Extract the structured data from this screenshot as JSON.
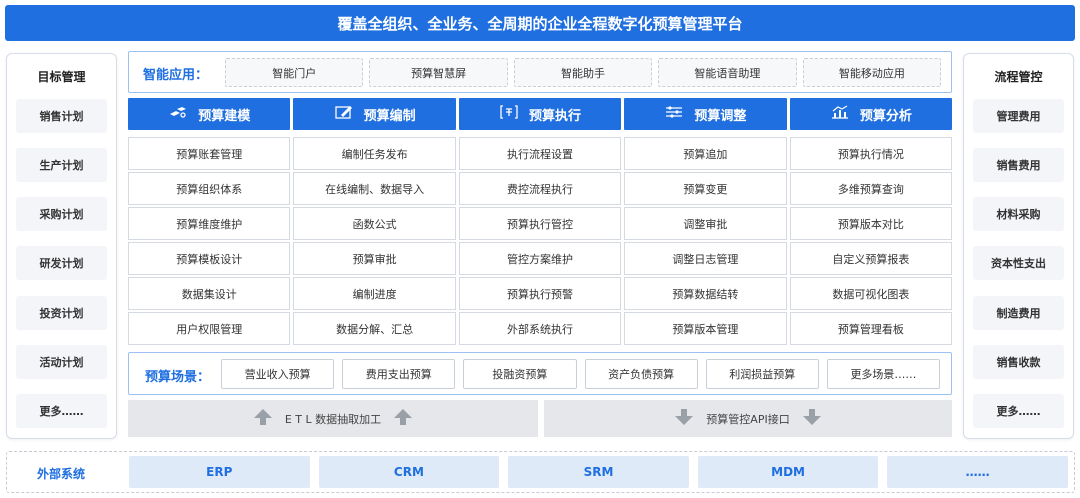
{
  "banner": {
    "title": "覆盖全组织、全业务、全周期的企业全程数字化预算管理平台"
  },
  "left_panel": {
    "title": "目标管理",
    "items": [
      "销售计划",
      "生产计划",
      "采购计划",
      "研发计划",
      "投资计划",
      "活动计划",
      "更多……"
    ]
  },
  "right_panel": {
    "title": "流程管控",
    "items": [
      "管理费用",
      "销售费用",
      "材料采购",
      "资本性支出",
      "制造费用",
      "销售收款",
      "更多……"
    ]
  },
  "smart_apps": {
    "label": "智能应用：",
    "items": [
      "智能门户",
      "预算智慧屏",
      "智能助手",
      "智能语音助理",
      "智能移动应用"
    ]
  },
  "modules": [
    {
      "title": "预算建模",
      "icon": "modeling-icon",
      "items": [
        "预算账套管理",
        "预算组织体系",
        "预算维度维护",
        "预算模板设计",
        "数据集设计",
        "用户权限管理"
      ]
    },
    {
      "title": "预算编制",
      "icon": "edit-icon",
      "items": [
        "编制任务发布",
        "在线编制、数据导入",
        "函数公式",
        "预算审批",
        "编制进度",
        "数据分解、汇总"
      ]
    },
    {
      "title": "预算执行",
      "icon": "execute-icon",
      "items": [
        "执行流程设置",
        "费控流程执行",
        "预算执行管控",
        "管控方案维护",
        "预算执行预警",
        "外部系统执行"
      ]
    },
    {
      "title": "预算调整",
      "icon": "adjust-icon",
      "items": [
        "预算追加",
        "预算变更",
        "调整审批",
        "调整日志管理",
        "预算数据结转",
        "预算版本管理"
      ]
    },
    {
      "title": "预算分析",
      "icon": "analysis-icon",
      "items": [
        "预算执行情况",
        "多维预算查询",
        "预算版本对比",
        "自定义预算报表",
        "数据可视化图表",
        "预算管理看板"
      ]
    }
  ],
  "scenes": {
    "label": "预算场景：",
    "items": [
      "营业收入预算",
      "费用支出预算",
      "投融资预算",
      "资产负债预算",
      "利润损益预算",
      "更多场景……"
    ]
  },
  "etl": {
    "label": "E T L 数据抽取加工"
  },
  "api": {
    "label": "预算管控API接口"
  },
  "external": {
    "label": "外部系统",
    "items": [
      "ERP",
      "CRM",
      "SRM",
      "MDM",
      "……"
    ]
  },
  "colors": {
    "primary": "#1f6fe0",
    "cell_bg": "#f3f5f9",
    "ext_bg": "#dfeaf8"
  }
}
